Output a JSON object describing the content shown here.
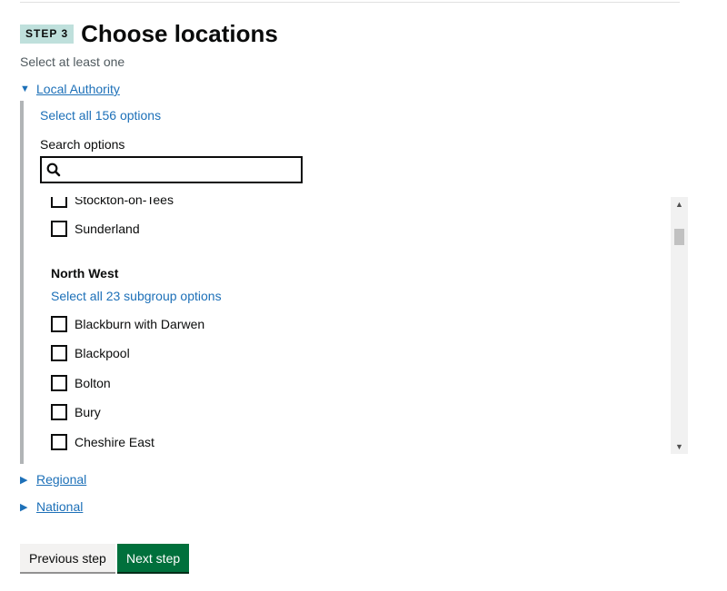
{
  "step": {
    "badge": "STEP 3",
    "title": "Choose locations",
    "hint": "Select at least one"
  },
  "groups": {
    "local_authority": {
      "label": "Local Authority",
      "expanded": true,
      "select_all": "Select all 156 options",
      "search_label": "Search options",
      "search_value": "",
      "options_before": [
        {
          "label": "Stockton-on-Tees",
          "checked": false
        },
        {
          "label": "Sunderland",
          "checked": false
        }
      ],
      "subgroup": {
        "heading": "North West",
        "select_all": "Select all 23 subgroup options",
        "options": [
          {
            "label": "Blackburn with Darwen",
            "checked": false
          },
          {
            "label": "Blackpool",
            "checked": false
          },
          {
            "label": "Bolton",
            "checked": false
          },
          {
            "label": "Bury",
            "checked": false
          },
          {
            "label": "Cheshire East",
            "checked": false
          }
        ]
      }
    },
    "regional": {
      "label": "Regional",
      "expanded": false
    },
    "national": {
      "label": "National",
      "expanded": false
    }
  },
  "icons": {
    "expanded": "triangle-down-icon",
    "collapsed": "triangle-right-icon",
    "search": "search-icon",
    "scroll_up": "scroll-up-icon",
    "scroll_down": "scroll-down-icon"
  },
  "buttons": {
    "previous": "Previous step",
    "next": "Next step"
  },
  "colors": {
    "link": "#1d70b8",
    "primary_button": "#00703c",
    "badge": "#bfe0dc"
  }
}
